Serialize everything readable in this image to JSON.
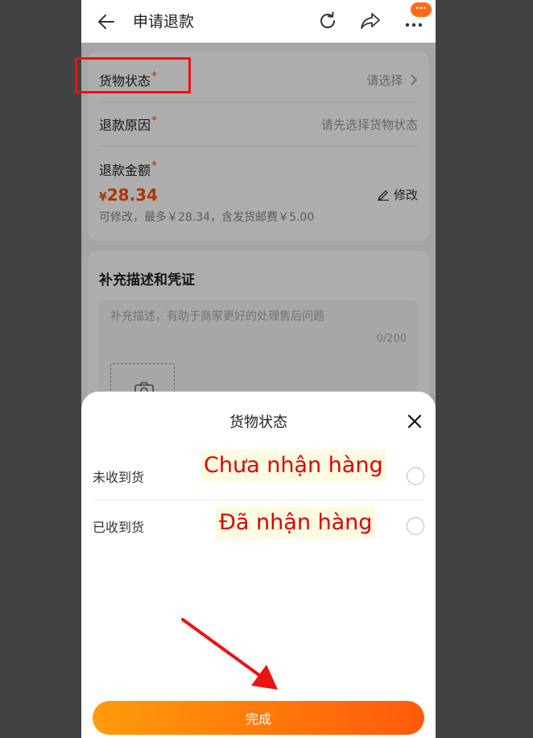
{
  "header": {
    "title": "申请退款",
    "badge": "···",
    "icons": [
      "arrow-left-icon",
      "refresh-icon",
      "share-icon",
      "more-icon"
    ]
  },
  "form": {
    "goods_status": {
      "label": "货物状态",
      "required_mark": "*",
      "value": "请选择"
    },
    "refund_reason": {
      "label": "退款原因",
      "required_mark": "*",
      "value": "请先选择货物状态"
    },
    "refund_amount": {
      "label": "退款金额",
      "required_mark": "*",
      "currency": "¥",
      "amount": "28.34",
      "edit_label": "修改",
      "hint": "可修改，最多￥28.34，含发货邮费￥5.00"
    }
  },
  "supplement": {
    "title": "补充描述和凭证",
    "placeholder": "补充描述，有助于商家更好的处理售后问题",
    "char_count": "0/200"
  },
  "sheet": {
    "title": "货物状态",
    "options": [
      {
        "label": "未收到货",
        "annotation": "Chưa nhận hàng"
      },
      {
        "label": "已收到货",
        "annotation": "Đã nhận hàng"
      }
    ],
    "confirm_label": "完成"
  },
  "colors": {
    "accent": "#ff5000",
    "button_gradient_start": "#ff9c0a",
    "button_gradient_end": "#ff5a0a",
    "annotation_red": "#e00000"
  }
}
